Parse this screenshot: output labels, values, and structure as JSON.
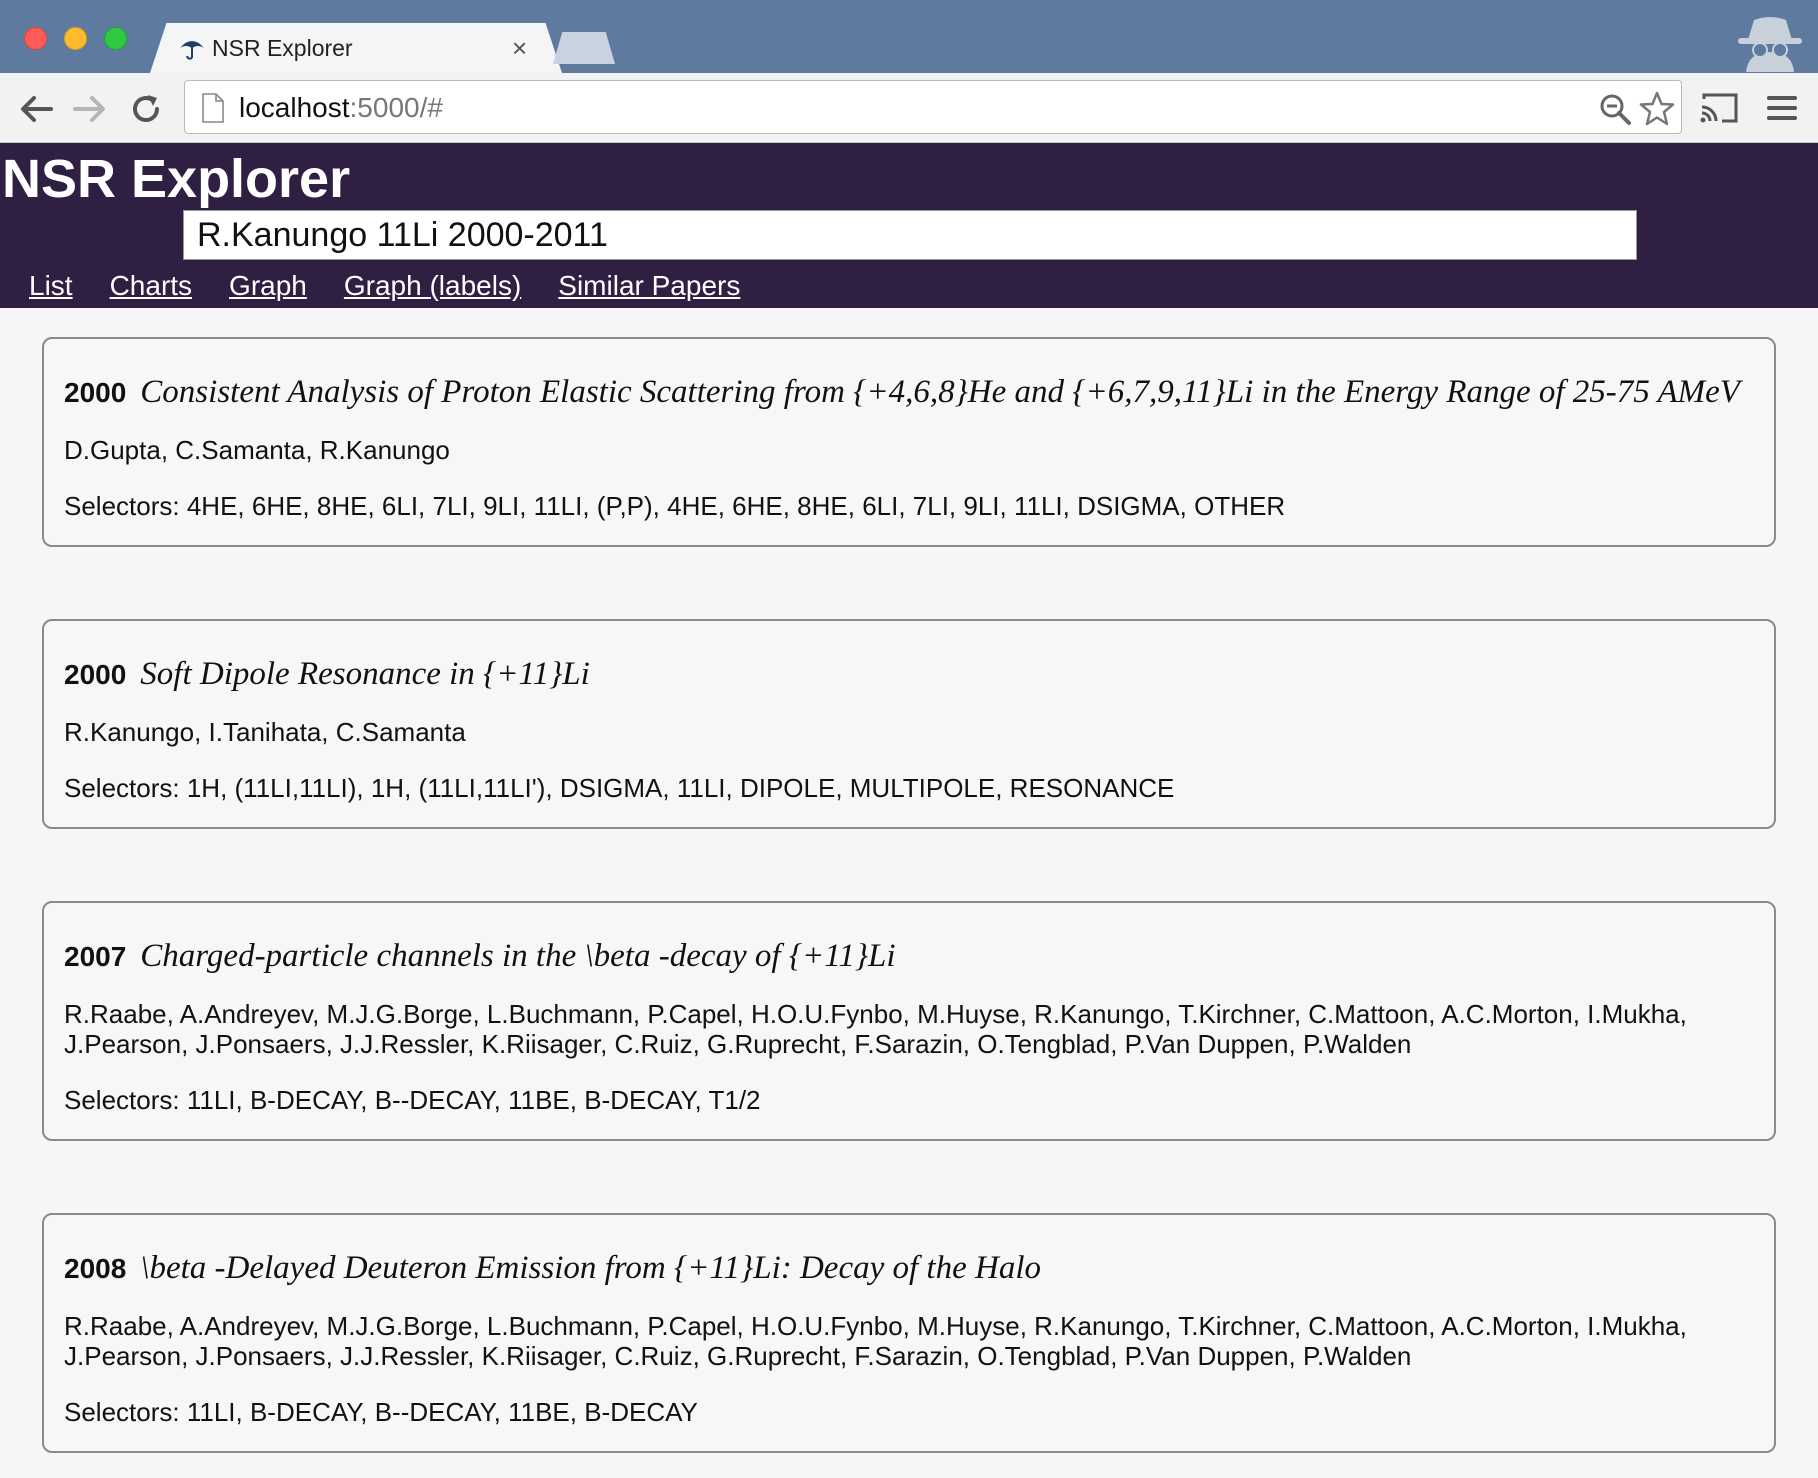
{
  "browser": {
    "tab_title": "NSR Explorer",
    "close_glyph": "×",
    "url_host": "localhost",
    "url_rest": ":5000/#",
    "icons": [
      "back-arrow-icon",
      "forward-arrow-icon",
      "reload-icon",
      "page-icon",
      "zoom-icon",
      "star-icon",
      "cast-icon",
      "menu-icon",
      "incognito-icon",
      "tab-favicon-icon"
    ]
  },
  "app": {
    "title": "NSR Explorer",
    "search_value": "R.Kanungo 11Li 2000-2011",
    "nav": [
      "List",
      "Charts",
      "Graph",
      "Graph (labels)",
      "Similar Papers"
    ],
    "colors": {
      "header_bg": "#2f1f43",
      "page_bg": "#f6f6f6"
    }
  },
  "papers": [
    {
      "year": "2000",
      "title": "Consistent Analysis of Proton Elastic Scattering from {+4,6,8}He and {+6,7,9,11}Li in the Energy Range of 25-75 AMeV",
      "authors": "D.Gupta, C.Samanta, R.Kanungo",
      "selectors": "Selectors: 4HE, 6HE, 8HE, 6LI, 7LI, 9LI, 11LI, (P,P), 4HE, 6HE, 8HE, 6LI, 7LI, 9LI, 11LI, DSIGMA, OTHER"
    },
    {
      "year": "2000",
      "title": "Soft Dipole Resonance in {+11}Li",
      "authors": "R.Kanungo, I.Tanihata, C.Samanta",
      "selectors": "Selectors: 1H, (11LI,11LI), 1H, (11LI,11LI'), DSIGMA, 11LI, DIPOLE, MULTIPOLE, RESONANCE"
    },
    {
      "year": "2007",
      "title": "Charged-particle channels in the \\beta -decay of {+11}Li",
      "authors": "R.Raabe, A.Andreyev, M.J.G.Borge, L.Buchmann, P.Capel, H.O.U.Fynbo, M.Huyse, R.Kanungo, T.Kirchner, C.Mattoon, A.C.Morton, I.Mukha, J.Pearson, J.Ponsaers, J.J.Ressler, K.Riisager, C.Ruiz, G.Ruprecht, F.Sarazin, O.Tengblad, P.Van Duppen, P.Walden",
      "selectors": "Selectors: 11LI, B-DECAY, B--DECAY, 11BE, B-DECAY, T1/2"
    },
    {
      "year": "2008",
      "title": "\\beta -Delayed Deuteron Emission from {+11}Li: Decay of the Halo",
      "authors": "R.Raabe, A.Andreyev, M.J.G.Borge, L.Buchmann, P.Capel, H.O.U.Fynbo, M.Huyse, R.Kanungo, T.Kirchner, C.Mattoon, A.C.Morton, I.Mukha, J.Pearson, J.Ponsaers, J.J.Ressler, K.Riisager, C.Ruiz, G.Ruprecht, F.Sarazin, O.Tengblad, P.Van Duppen, P.Walden",
      "selectors": "Selectors: 11LI, B-DECAY, B--DECAY, 11BE, B-DECAY"
    }
  ]
}
